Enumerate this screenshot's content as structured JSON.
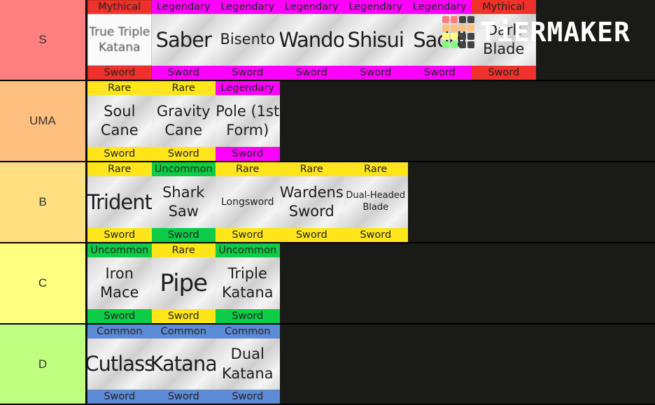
{
  "branding": {
    "logo_text": "TiERMAKER"
  },
  "rarity_colors": {
    "Mythical": "#f0302a",
    "Legendary": "#ff00ff",
    "Rare": "#ffe51a",
    "Uncommon": "#0dcc45",
    "Common": "#5b8ad6"
  },
  "tiers": [
    {
      "label": "S",
      "color": "#ff7f7f",
      "items": [
        {
          "rarity": "Mythical",
          "name": "True Triple\nKatana",
          "type": "Sword",
          "size": "sz-s",
          "faded": true
        },
        {
          "rarity": "Legendary",
          "name": "Saber",
          "type": "Sword",
          "size": "sz-l"
        },
        {
          "rarity": "Legendary",
          "name": "Bisento",
          "type": "Sword",
          "size": "sz-m"
        },
        {
          "rarity": "Legendary",
          "name": "Wando",
          "type": "Sword",
          "size": "sz-l"
        },
        {
          "rarity": "Legendary",
          "name": "Shisui",
          "type": "Sword",
          "size": "sz-l"
        },
        {
          "rarity": "Legendary",
          "name": "Saddi",
          "type": "Sword",
          "size": "sz-l"
        },
        {
          "rarity": "Mythical",
          "name": "Dark\nBlade",
          "type": "Sword",
          "size": "sz-m"
        }
      ]
    },
    {
      "label": "UMA",
      "color": "#ffbf7f",
      "items": [
        {
          "rarity": "Rare",
          "name": "Soul\nCane",
          "type": "Sword",
          "size": "sz-m"
        },
        {
          "rarity": "Rare",
          "name": "Gravity\nCane",
          "type": "Sword",
          "size": "sz-m"
        },
        {
          "rarity": "Legendary",
          "name": "Pole (1st\nForm)",
          "type": "Sword",
          "size": "sz-m"
        }
      ]
    },
    {
      "label": "B",
      "color": "#ffdf7f",
      "items": [
        {
          "rarity": "Rare",
          "name": "Trident",
          "type": "Sword",
          "size": "sz-l"
        },
        {
          "rarity": "Uncommon",
          "name": "Shark\nSaw",
          "type": "Sword",
          "size": "sz-m"
        },
        {
          "rarity": "Rare",
          "name": "Longsword",
          "type": "Sword",
          "size": "sz-xs"
        },
        {
          "rarity": "Rare",
          "name": "Wardens\nSword",
          "type": "Sword",
          "size": "sz-m"
        },
        {
          "rarity": "Rare",
          "name": "Dual-Headed\nBlade",
          "type": "Sword",
          "size": "sz-xxs"
        }
      ]
    },
    {
      "label": "C",
      "color": "#ffff7f",
      "items": [
        {
          "rarity": "Uncommon",
          "name": "Iron\nMace",
          "type": "Sword",
          "size": "sz-m"
        },
        {
          "rarity": "Rare",
          "name": "Pipe",
          "type": "Sword",
          "size": "sz-xl"
        },
        {
          "rarity": "Uncommon",
          "name": "Triple\nKatana",
          "type": "Sword",
          "size": "sz-m"
        }
      ]
    },
    {
      "label": "D",
      "color": "#bfff7f",
      "items": [
        {
          "rarity": "Common",
          "name": "Cutlass",
          "type": "Sword",
          "size": "sz-l"
        },
        {
          "rarity": "Common",
          "name": "Katana",
          "type": "Sword",
          "size": "sz-l"
        },
        {
          "rarity": "Common",
          "name": "Dual\nKatana",
          "type": "Sword",
          "size": "sz-m"
        }
      ]
    }
  ]
}
